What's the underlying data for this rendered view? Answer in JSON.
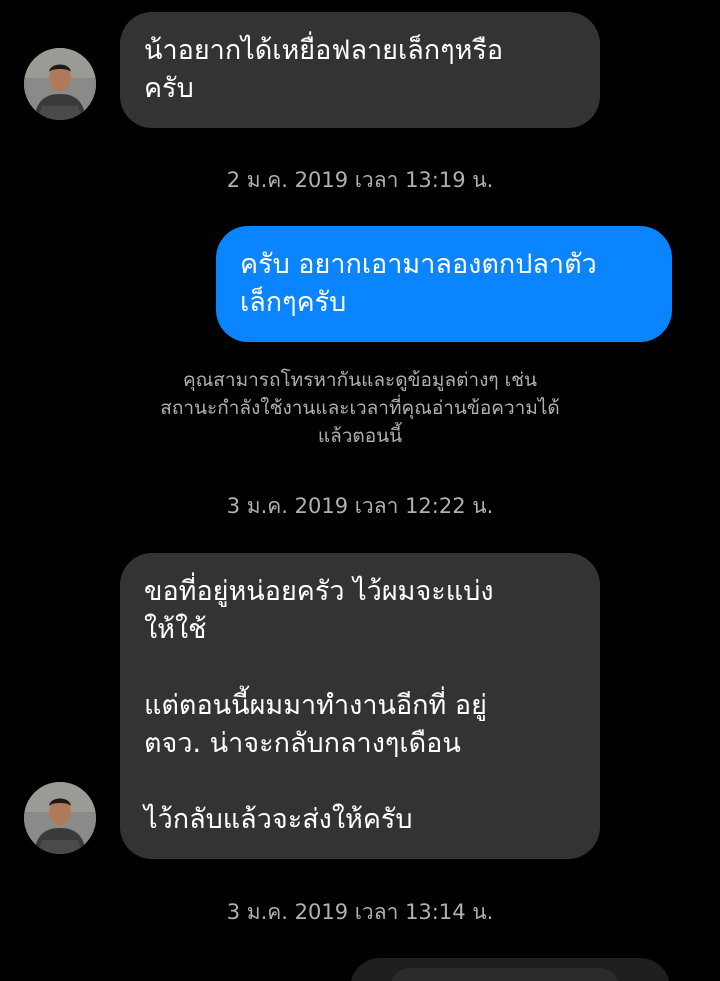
{
  "conversation": {
    "messages": [
      {
        "direction": "incoming",
        "text": "น้าอยากได้เหยื่อฟลายเล็กๆหรือ\nครับ"
      },
      {
        "direction": "outgoing",
        "text": "ครับ อยากเอามาลองตกปลาตัว\nเล็กๆครับ"
      },
      {
        "direction": "incoming",
        "text": "ขอที่อยู่หน่อยครัว ไว้ผมจะแบ่ง\nให้ใช้\n\nแต่ตอนนี้ผมมาทำงานอีกที่ อยู่\nตจว.  น่าจะกลับกลางๆเดือน\n\nไว้กลับแล้วจะส่งให้ครับ"
      }
    ],
    "timestamps": [
      "2 ม.ค. 2019 เวลา 13:19 น.",
      "3 ม.ค. 2019 เวลา 12:22 น.",
      "3 ม.ค. 2019 เวลา 13:14 น."
    ],
    "system_notice": "คุณสามารถโทรหากันและดูข้อมูลต่างๆ เช่น\nสถานะกำลังใช้งานและเวลาที่คุณอ่านข้อความได้\nแล้วตอนนี้"
  },
  "colors": {
    "background": "#000000",
    "incoming_bubble": "#333333",
    "outgoing_bubble": "#0a84ff",
    "meta_text": "#b0b0b0"
  },
  "icons": {
    "avatar": "contact-avatar-photo"
  }
}
